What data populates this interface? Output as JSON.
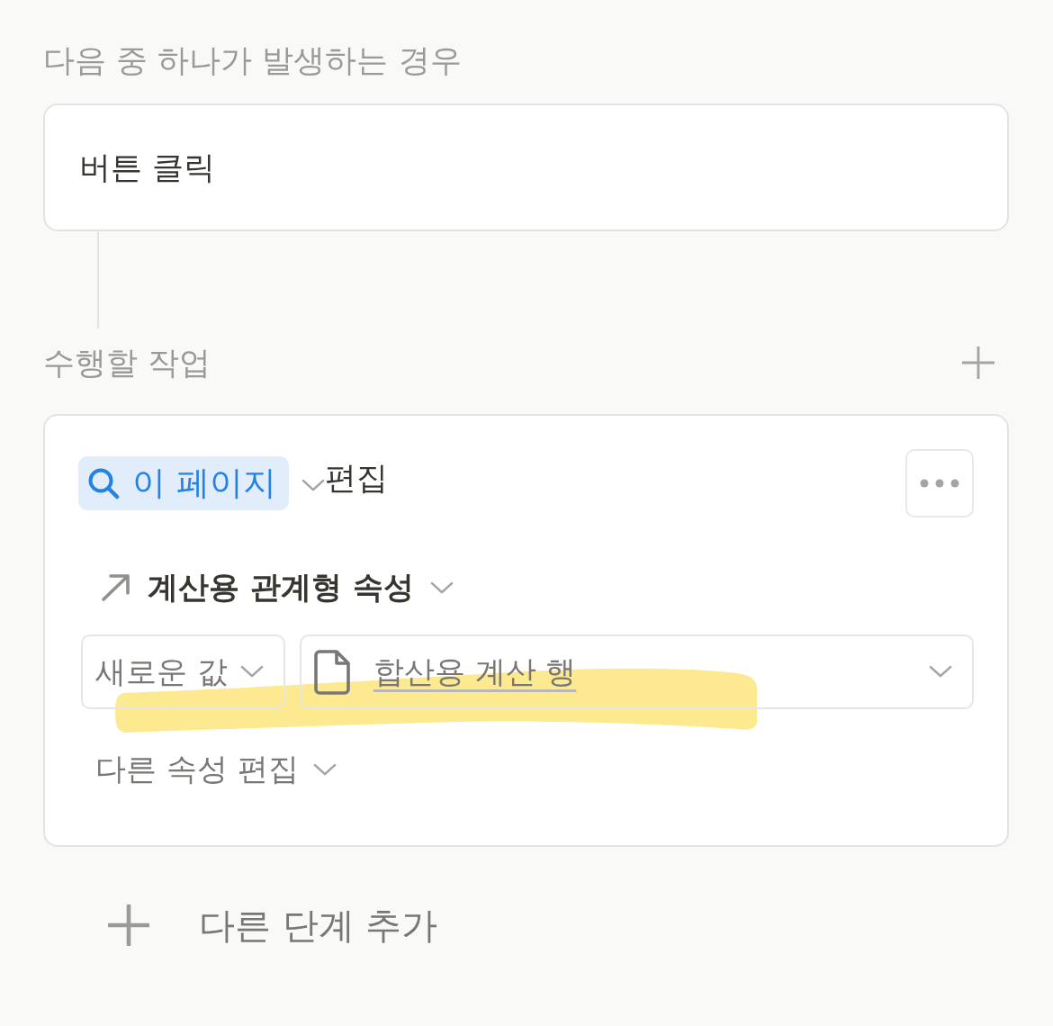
{
  "trigger": {
    "heading": "다음 중 하나가 발생하는 경우",
    "items": [
      {
        "label": "버튼 클릭"
      }
    ]
  },
  "actions": {
    "heading": "수행할 작업",
    "steps": [
      {
        "kind": "edit_page",
        "target": "이 페이지",
        "verb": "편집",
        "properties": [
          {
            "name": "계산용 관계형 속성",
            "mode": "새로운 값",
            "value": "합산용 계산 행",
            "highlighted": true
          }
        ],
        "more_label": "다른 속성 편집"
      }
    ]
  },
  "add_step": {
    "label": "다른 단계 추가"
  }
}
